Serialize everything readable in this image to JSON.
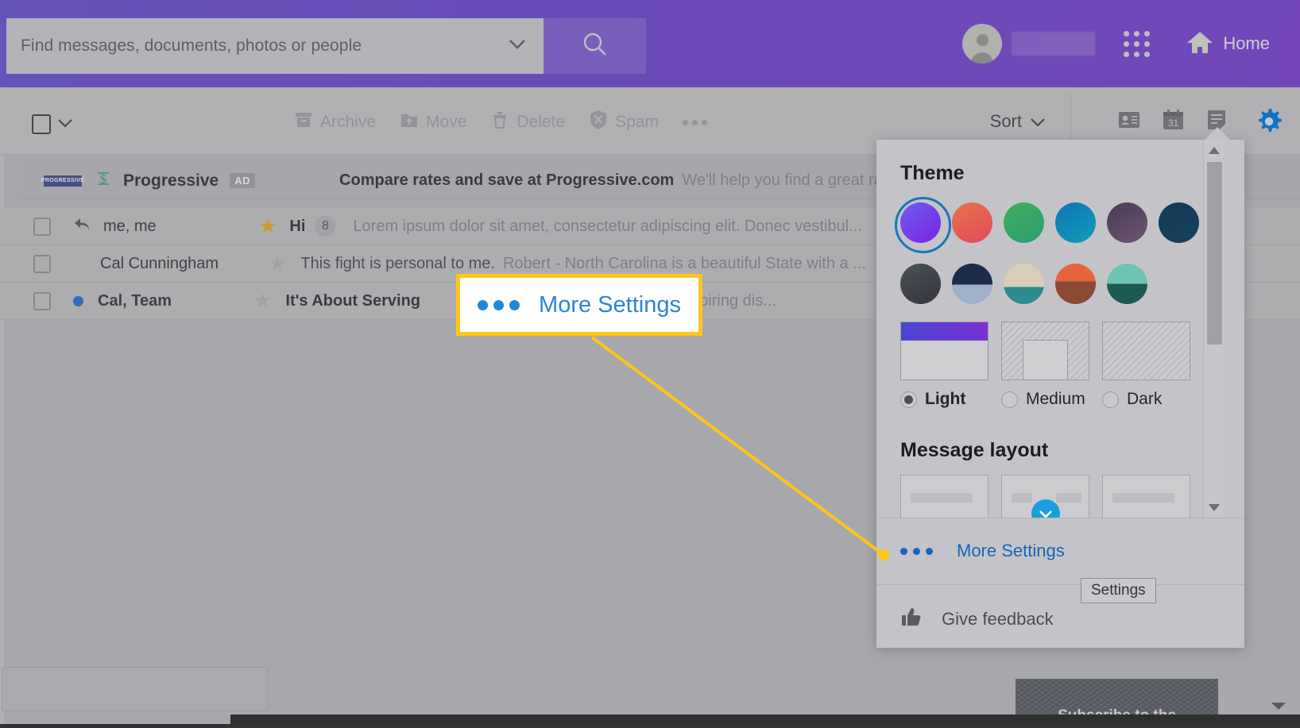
{
  "topbar": {
    "search_placeholder": "Find messages, documents, photos or people",
    "search_value": "",
    "search_chevron_icon": "chevron-down-icon",
    "search_button_icon": "search-icon",
    "apps_grid_icon": "apps-grid-icon",
    "home_icon": "home-icon",
    "home_label": "Home",
    "avatar_icon": "avatar-icon",
    "accent_purple": "#6134cf"
  },
  "toolbar": {
    "select_all_icon": "checkbox-icon",
    "select_chevron_icon": "chevron-down-icon",
    "actions": [
      {
        "label": "Archive",
        "icon": "archive-icon"
      },
      {
        "label": "Move",
        "icon": "move-folder-icon"
      },
      {
        "label": "Delete",
        "icon": "trash-icon"
      },
      {
        "label": "Spam",
        "icon": "spam-shield-icon"
      }
    ],
    "overflow_icon": "ellipsis-icon",
    "sort_label": "Sort",
    "sort_chevron_icon": "chevron-down-icon",
    "right_icons": [
      {
        "name": "contacts-icon"
      },
      {
        "name": "calendar-icon",
        "label": "31"
      },
      {
        "name": "notepad-icon"
      }
    ],
    "settings_gear_icon": "gear-icon",
    "gear_color": "#1172c4"
  },
  "mail_list": {
    "rows": [
      {
        "type": "ad",
        "logo_text": "PROGRESSIVE",
        "sender": "Progressive",
        "badge": "AD",
        "subject": "Compare rates and save at Progressive.com",
        "snippet": "We'll help you find a great rate. Even"
      },
      {
        "type": "message",
        "sender": "me, me",
        "reply_icon": "reply-icon",
        "starred": true,
        "subject": "Hi",
        "count": "8",
        "snippet": "Lorem ipsum dolor sit amet, consectetur adipiscing elit. Donec vestibul..."
      },
      {
        "type": "message",
        "sender": "Cal Cunningham",
        "starred": false,
        "subject": "This fight is personal to me.",
        "snippet": "Robert - North Carolina is a beautiful State with a ..."
      },
      {
        "type": "message",
        "sender": "Cal, Team",
        "unread": true,
        "starred": false,
        "subject": "It's About Serving",
        "snippet": "such an inspiring dis..."
      }
    ]
  },
  "settings_panel": {
    "theme_heading": "Theme",
    "theme_swatches_row1": [
      {
        "name": "theme-purple",
        "css": "linear-gradient(140deg,#6f5cf0,#7a24e0)",
        "selected": true
      },
      {
        "name": "theme-sunset",
        "css": "linear-gradient(150deg,#e8734a,#e04a5e)",
        "selected": false
      },
      {
        "name": "theme-green",
        "css": "linear-gradient(150deg,#3fae5a,#2e9e72)",
        "selected": false
      },
      {
        "name": "theme-blue",
        "css": "linear-gradient(150deg,#1073b6,#0f9fb5)",
        "selected": false
      },
      {
        "name": "theme-plum",
        "css": "linear-gradient(150deg,#4b3a55,#6b5574)",
        "selected": false
      },
      {
        "name": "theme-navy",
        "css": "linear-gradient(150deg,#123a55,#16405e)",
        "selected": false
      }
    ],
    "theme_swatches_row2": [
      {
        "name": "theme-charcoal",
        "css": "linear-gradient(150deg,#4c5158,#33373c)"
      },
      {
        "name": "theme-mountain",
        "css": "linear-gradient(180deg,#1d2c4d 55%,#9fb1c9 55%)"
      },
      {
        "name": "theme-van",
        "css": "linear-gradient(180deg,#d9cdb8 60%,#2c8c90 60%)"
      },
      {
        "name": "theme-desert",
        "css": "linear-gradient(180deg,#e8643c 45%,#8a4a33 45%)"
      },
      {
        "name": "theme-lake",
        "css": "linear-gradient(180deg,#6fc3b2 50%,#1d5b52 50%)"
      }
    ],
    "density_options": [
      {
        "label": "Light",
        "selected": true,
        "preview": "light"
      },
      {
        "label": "Medium",
        "selected": false,
        "preview": "medium"
      },
      {
        "label": "Dark",
        "selected": false,
        "preview": "dark"
      }
    ],
    "message_layout_heading": "Message layout",
    "message_layout_previews": 3,
    "more_settings_label": "More Settings",
    "more_settings_icon": "ellipsis-icon",
    "give_feedback_label": "Give feedback",
    "give_feedback_icon": "thumbs-up-icon",
    "scrollbar_up_icon": "caret-up-icon",
    "scrollbar_down_icon": "caret-down-icon"
  },
  "tooltip": {
    "text": "Settings"
  },
  "callout": {
    "label": "More Settings",
    "icon": "ellipsis-icon",
    "border_color": "#ffc61a",
    "text_color": "#2b84d8"
  },
  "bottom": {
    "ad_tile_text": "Subscribe to the",
    "scroll_down_icon": "caret-down-icon"
  }
}
